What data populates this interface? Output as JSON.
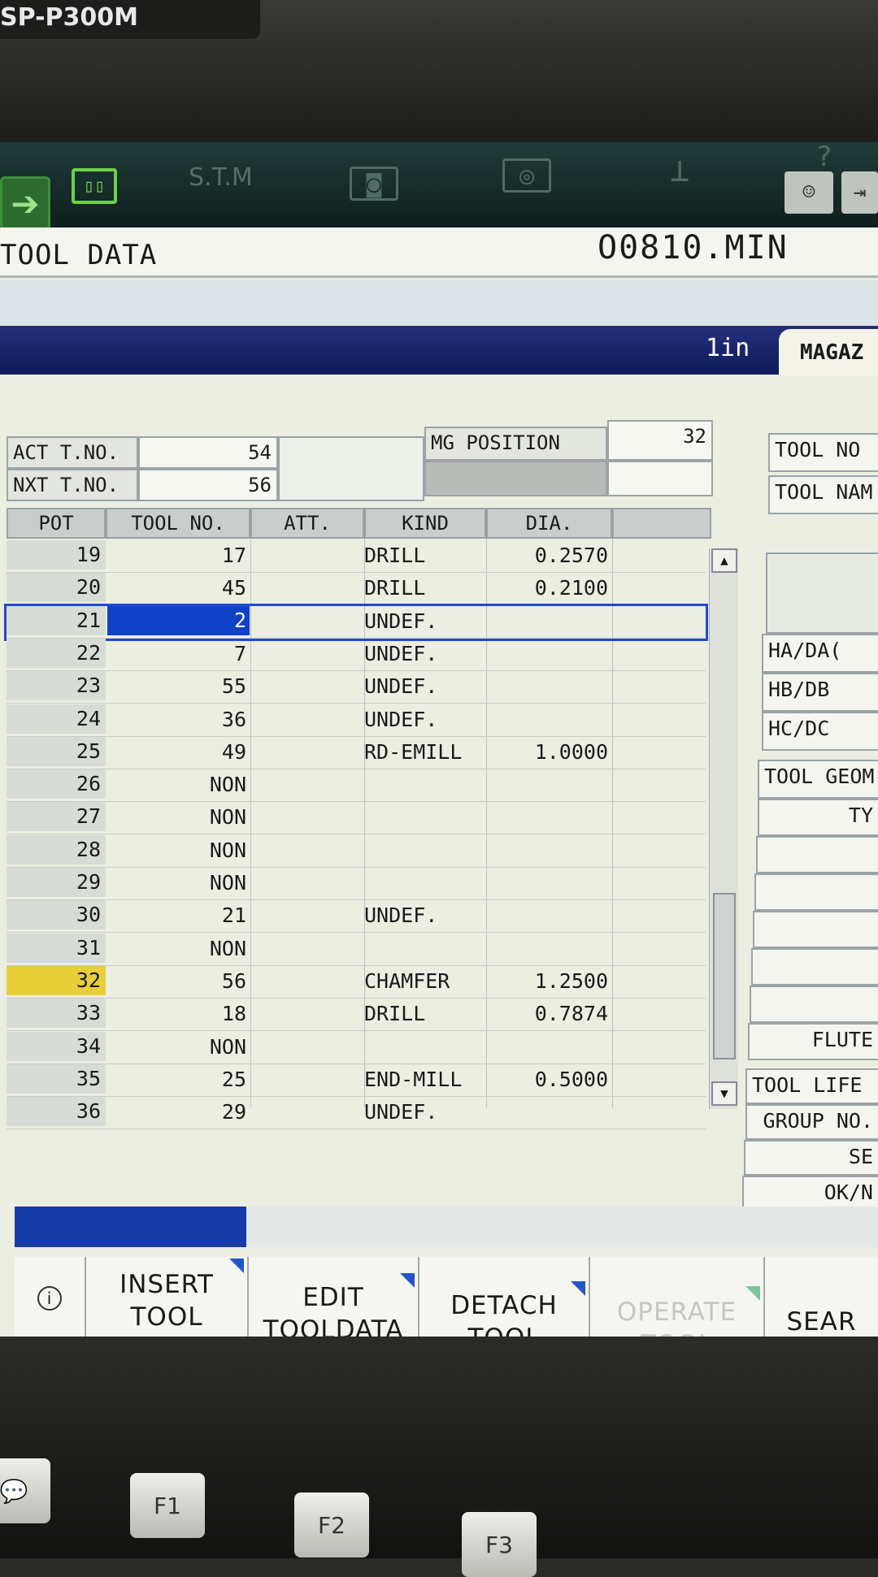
{
  "machine_model": "SP-P300M",
  "icon_bar": {
    "stm_label": "S.T.M",
    "help_symbol": "?"
  },
  "header": {
    "title": "TOOL DATA",
    "program": "O0810.MIN"
  },
  "tabs": {
    "unit": "1in",
    "magazine": "MAGAZ"
  },
  "status": {
    "act_label": "ACT T.NO.",
    "act_value": "54",
    "nxt_label": "NXT T.NO.",
    "nxt_value": "56",
    "mg_label": "MG POSITION",
    "mg_value": "32"
  },
  "table": {
    "headers": [
      "POT",
      "TOOL NO.",
      "ATT.",
      "KIND",
      "DIA."
    ],
    "rows": [
      {
        "pot": "19",
        "tool": "17",
        "kind": "DRILL",
        "dia": "0.2570"
      },
      {
        "pot": "20",
        "tool": "45",
        "kind": "DRILL",
        "dia": "0.2100"
      },
      {
        "pot": "21",
        "tool": "2",
        "kind": "UNDEF.",
        "dia": ""
      },
      {
        "pot": "22",
        "tool": "7",
        "kind": "UNDEF.",
        "dia": ""
      },
      {
        "pot": "23",
        "tool": "55",
        "kind": "UNDEF.",
        "dia": ""
      },
      {
        "pot": "24",
        "tool": "36",
        "kind": "UNDEF.",
        "dia": ""
      },
      {
        "pot": "25",
        "tool": "49",
        "kind": "RD-EMILL",
        "dia": "1.0000"
      },
      {
        "pot": "26",
        "tool": "NON",
        "kind": "",
        "dia": ""
      },
      {
        "pot": "27",
        "tool": "NON",
        "kind": "",
        "dia": ""
      },
      {
        "pot": "28",
        "tool": "NON",
        "kind": "",
        "dia": ""
      },
      {
        "pot": "29",
        "tool": "NON",
        "kind": "",
        "dia": ""
      },
      {
        "pot": "30",
        "tool": "21",
        "kind": "UNDEF.",
        "dia": ""
      },
      {
        "pot": "31",
        "tool": "NON",
        "kind": "",
        "dia": ""
      },
      {
        "pot": "32",
        "tool": "56",
        "kind": "CHAMFER",
        "dia": "1.2500"
      },
      {
        "pot": "33",
        "tool": "18",
        "kind": "DRILL",
        "dia": "0.7874"
      },
      {
        "pot": "34",
        "tool": "NON",
        "kind": "",
        "dia": ""
      },
      {
        "pot": "35",
        "tool": "25",
        "kind": "END-MILL",
        "dia": "0.5000"
      },
      {
        "pot": "36",
        "tool": "29",
        "kind": "UNDEF.",
        "dia": ""
      }
    ]
  },
  "right_panel": {
    "tool_no": "TOOL NO",
    "tool_name": "TOOL NAM",
    "ha": "HA/DA(",
    "hb": "HB/DB",
    "hc": "HC/DC",
    "geom": "TOOL GEOM",
    "ty": "TY",
    "flute": "FLUTE",
    "life": "TOOL LIFE",
    "group": "GROUP NO.",
    "se": "SE",
    "ok": "OK/N"
  },
  "softkeys": {
    "info_symbol": "i",
    "insert_1": "INSERT",
    "insert_2": "TOOL",
    "edit_1": "EDIT",
    "edit_2": "TOOLDATA",
    "detach_1": "DETACH",
    "detach_2": "TOOL",
    "operate_1": "OPERATE",
    "operate_2": "TOOL",
    "search": "SEAR"
  },
  "fkeys": [
    "F1",
    "F2",
    "F3"
  ]
}
